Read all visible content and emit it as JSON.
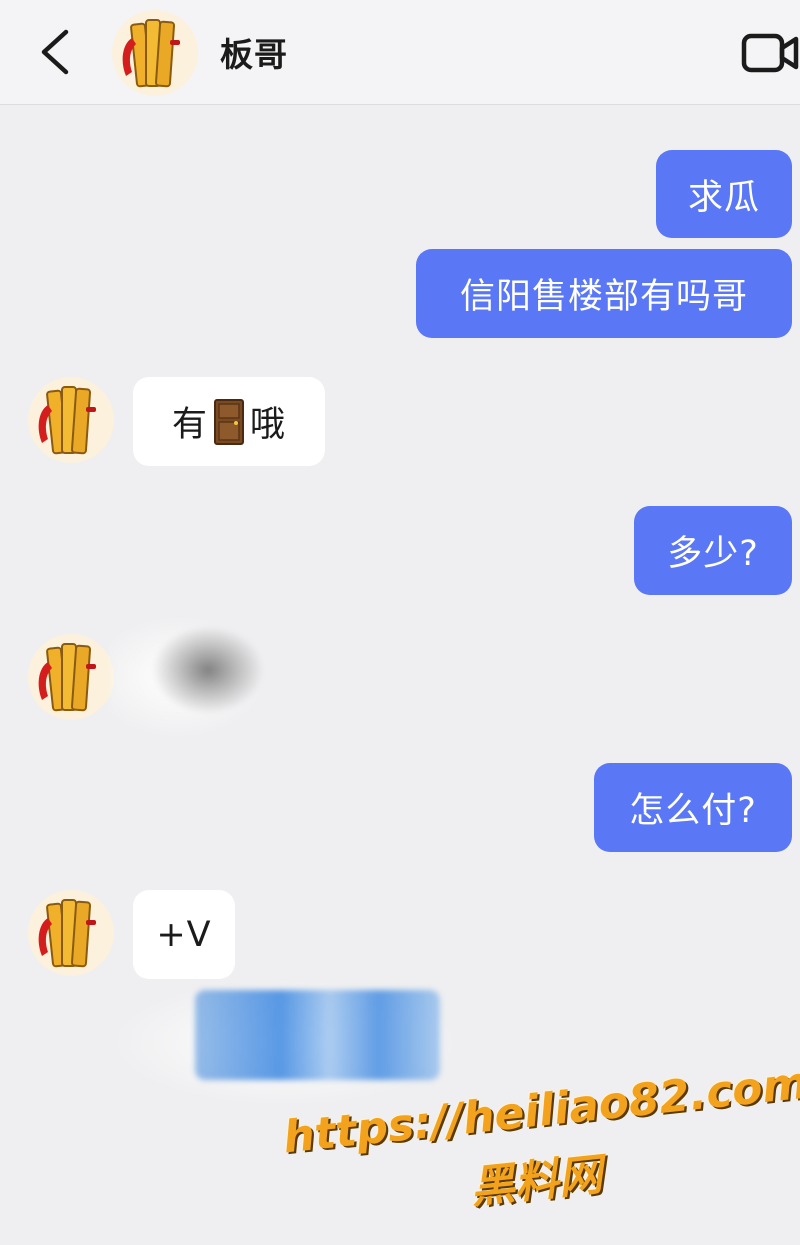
{
  "header": {
    "contact_name": "板哥",
    "back_icon": "chevron-left-icon",
    "video_icon": "video-camera-icon",
    "avatar_icon": "stacked-boards-avatar"
  },
  "messages": [
    {
      "side": "out",
      "text": "求瓜"
    },
    {
      "side": "out",
      "text": "信阳售楼部有吗哥"
    },
    {
      "side": "in",
      "text_before": "有",
      "emoji": "door-emoji",
      "text_after": "哦"
    },
    {
      "side": "out",
      "text": "多少?"
    },
    {
      "side": "in",
      "redacted": true
    },
    {
      "side": "out",
      "text": "怎么付?"
    },
    {
      "side": "in",
      "text": "+V"
    }
  ],
  "watermark": {
    "url": "https://heiliao82.com",
    "label": "黑料网"
  },
  "colors": {
    "outgoing_bubble": "#5a77f5",
    "incoming_bubble": "#ffffff",
    "background": "#efeff1",
    "watermark": "#f2a21c"
  }
}
